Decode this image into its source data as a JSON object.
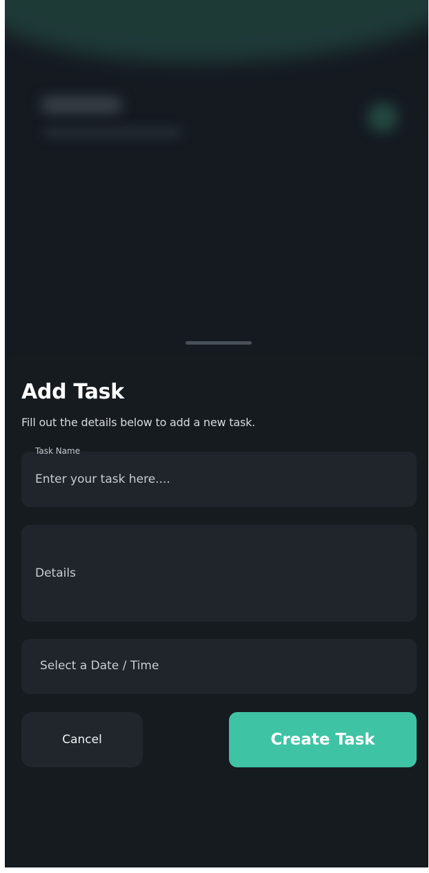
{
  "sheet": {
    "title": "Add Task",
    "subtitle": "Fill out the details below to add a new task."
  },
  "form": {
    "task_name": {
      "label": "Task Name",
      "placeholder": "Enter your task here....",
      "value": ""
    },
    "details": {
      "placeholder": "Details",
      "value": ""
    },
    "date_time": {
      "placeholder": "Select a Date / Time"
    }
  },
  "actions": {
    "cancel_label": "Cancel",
    "create_label": "Create Task"
  },
  "colors": {
    "background": "#151a21",
    "sheet": "#161b20",
    "field": "#1f252b",
    "accent": "#3fc3a5",
    "text": "#ffffff"
  }
}
